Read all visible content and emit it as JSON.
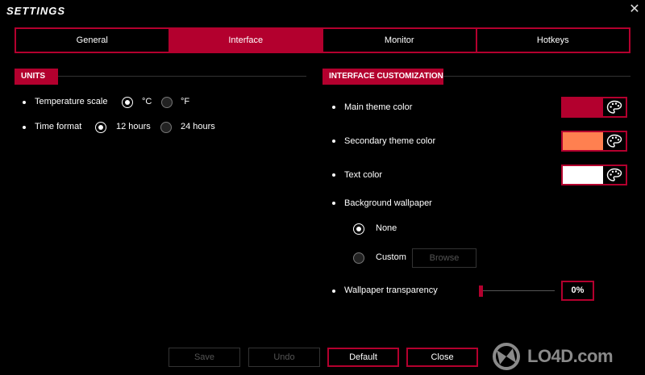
{
  "window": {
    "title": "SETTINGS",
    "close_glyph": "✕"
  },
  "tabs": [
    {
      "label": "General",
      "active": false
    },
    {
      "label": "Interface",
      "active": true
    },
    {
      "label": "Monitor",
      "active": false
    },
    {
      "label": "Hotkeys",
      "active": false
    }
  ],
  "units": {
    "header": "UNITS",
    "temperature": {
      "label": "Temperature scale",
      "options": [
        "°C",
        "°F"
      ],
      "selected": "°C"
    },
    "time": {
      "label": "Time format",
      "options": [
        "12 hours",
        "24 hours"
      ],
      "selected": "12 hours"
    }
  },
  "customization": {
    "header": "INTERFACE CUSTOMIZATION",
    "main_theme": {
      "label": "Main theme color",
      "color": "#b3002e"
    },
    "secondary_theme": {
      "label": "Secondary theme color",
      "color": "#ff8050"
    },
    "text_color": {
      "label": "Text color",
      "color": "#ffffff"
    },
    "wallpaper": {
      "label": "Background wallpaper",
      "options": [
        "None",
        "Custom"
      ],
      "selected": "None",
      "browse_label": "Browse"
    },
    "transparency": {
      "label": "Wallpaper transparency",
      "value": "0%",
      "level": 0
    }
  },
  "footer": {
    "save": "Save",
    "undo": "Undo",
    "default": "Default",
    "close": "Close"
  },
  "watermark": {
    "text": "LO4D.com"
  },
  "accent": "#b3002e",
  "icons": {
    "palette": "palette-icon",
    "close": "close-icon"
  }
}
